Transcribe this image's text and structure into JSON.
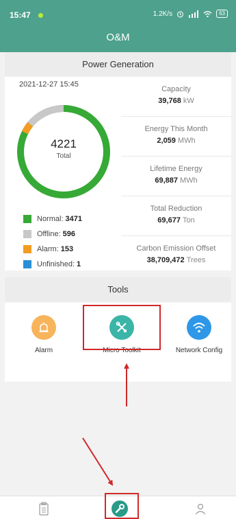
{
  "status_bar": {
    "time": "15:47",
    "network_speed": "1.2K/s",
    "battery": "63"
  },
  "app": {
    "title": "O&M"
  },
  "power_generation": {
    "header": "Power Generation",
    "timestamp": "2021-12-27 15:45",
    "total_value": "4221",
    "total_label": "Total",
    "legend": [
      {
        "label": "Normal:",
        "value": "3471",
        "color": "#36a936"
      },
      {
        "label": "Offline:",
        "value": "596",
        "color": "#c8c8c8"
      },
      {
        "label": "Alarm:",
        "value": "153",
        "color": "#f39c22"
      },
      {
        "label": "Unfinished:",
        "value": "1",
        "color": "#2a8fd6"
      }
    ],
    "stats": [
      {
        "title": "Capacity",
        "value": "39,768",
        "unit": "kW"
      },
      {
        "title": "Energy This Month",
        "value": "2,059",
        "unit": "MWh"
      },
      {
        "title": "Lifetime Energy",
        "value": "69,887",
        "unit": "MWh"
      },
      {
        "title": "Total Reduction",
        "value": "69,677",
        "unit": "Ton"
      },
      {
        "title": "Carbon Emission Offset",
        "value": "38,709,472",
        "unit": "Trees"
      }
    ]
  },
  "tools": {
    "header": "Tools",
    "items": [
      {
        "label": "Alarm",
        "icon": "alarm-icon",
        "color": "#f7b45a"
      },
      {
        "label": "Micro Toolkit",
        "icon": "toolkit-icon",
        "color": "#3ab5a8"
      },
      {
        "label": "Network Config",
        "icon": "wifi-icon",
        "color": "#2f97e8"
      }
    ]
  },
  "bottom_nav": [
    {
      "icon": "clipboard-icon"
    },
    {
      "icon": "wrench-icon",
      "active": true
    },
    {
      "icon": "user-icon"
    }
  ],
  "colors": {
    "header_bg": "#4ea18c",
    "annotation_red": "#d0282a"
  }
}
